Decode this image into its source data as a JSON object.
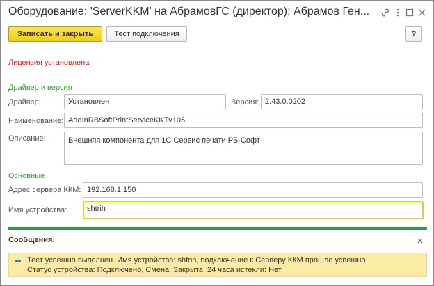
{
  "window": {
    "title": "Оборудование: 'ServerKKM' на АбрамовГС (директор); Абрамов Ген..."
  },
  "toolbar": {
    "save_close_label": "Записать и закрыть",
    "test_connection_label": "Тест подключения",
    "help_label": "?"
  },
  "license_status": "Лицензия установлена",
  "driver_group": {
    "title": "Драйвер и версия",
    "driver_label": "Драйвер:",
    "driver_value": "Установлен",
    "version_label": "Версия:",
    "version_value": "2.43.0.0202",
    "name_label": "Наименование:",
    "name_value": "AddInRBSoftPrintServiceKKTv105",
    "description_label": "Описание:",
    "description_value": "Внешняя компонента для 1С Сервис печати РБ-Софт"
  },
  "main_group": {
    "title": "Основные",
    "server_address_label": "Адрес сервера ККМ:",
    "server_address_value": "192.168.1.150",
    "device_name_label": "Имя устройства:",
    "device_name_value": "shtrih"
  },
  "messages": {
    "title": "Сообщения:",
    "lines": [
      "Тест успешно выполнен. Имя устройства: shtrih, подключение к Серверу ККМ прошло успешно",
      "Статус устройства: Подключено, Смена: Закрыта, 24 часа истекли: Нет"
    ]
  },
  "icons": {
    "titlebar": [
      "link-icon",
      "more-icon",
      "maximize-icon",
      "close-icon"
    ],
    "messages": [
      "close-icon"
    ]
  },
  "colors": {
    "accent_yellow": "#f2cd13",
    "group_title_green": "#3a9b3a",
    "license_red": "#e02020",
    "separator_green": "#2a9a45",
    "message_background": "#fbeba5"
  }
}
